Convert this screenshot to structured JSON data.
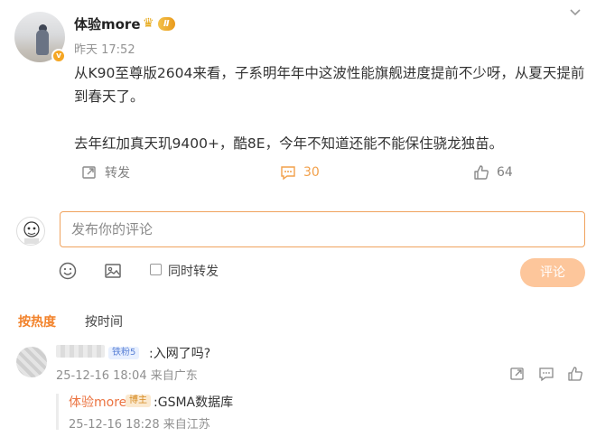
{
  "post": {
    "author": "体验more",
    "level_badge": "Ⅱ",
    "time": "昨天 17:52",
    "paragraph1": "从K90至尊版2604来看，子系明年年中这波性能旗舰进度提前不少呀，从夏天提前到春天了。",
    "paragraph2": "去年红加真天玑9400+，酷8E，今年不知道还能不能保住骁龙独苗。",
    "repost_label": "转发",
    "comment_count": "30",
    "like_count": "64"
  },
  "composer": {
    "placeholder": "发布你的评论",
    "repost_checkbox_label": "同时转发",
    "submit_label": "评论"
  },
  "sort_tabs": {
    "hot": "按热度",
    "time": "按时间"
  },
  "comments": [
    {
      "fan_badge": "铁粉5",
      "text": ":入网了吗?",
      "meta": "25-12-16 18:04 来自广东",
      "replies": [
        {
          "author": "体验more",
          "badge": "博主",
          "text": ":GSMA数据库",
          "meta": "25-12-16 18:28 来自江苏"
        }
      ]
    }
  ],
  "colors": {
    "accent": "#f2822a",
    "comment_active": "#f2a04a",
    "submit_disabled": "#fdc69b",
    "reply_author": "#eb7340"
  }
}
